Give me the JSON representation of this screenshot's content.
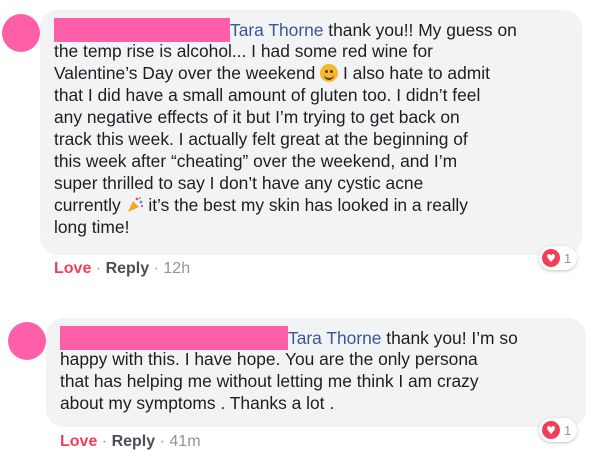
{
  "comments": [
    {
      "mention": "Tara Thorne",
      "lines": [
        " thank you!! My guess on",
        "the temp rise is alcohol... I had some red wine for",
        "Valentine’s Day over the weekend",
        " I also hate to admit",
        "that I did have a small amount of gluten too. I didn’t feel",
        "any negative effects of it but I’m trying to get back on",
        "track this week. I actually felt great at the beginning of",
        "this week after “cheating” over the weekend, and I’m",
        "super thrilled to say I don’t have any cystic acne",
        "currently",
        " it’s the best my skin has looked in a really",
        "long time!"
      ],
      "love_label": "Love",
      "reply_label": "Reply",
      "sep": "·",
      "time": "12h",
      "reaction_count": "1",
      "emoji_smile": "smiling-face-emoji",
      "emoji_party": "party-popper-emoji"
    },
    {
      "mention": "Tara Thorne",
      "lines": [
        " thank you! I’m so",
        "happy with this. I have hope. You are the only persona",
        "that has helping me without letting me think I am crazy",
        "about my symptoms . Thanks a lot ."
      ],
      "love_label": "Love",
      "reply_label": "Reply",
      "sep": "·",
      "time": "41m",
      "reaction_count": "1"
    }
  ],
  "colors": {
    "redaction": "#ff5fa8",
    "mention": "#385898",
    "love": "#f33e58",
    "bubble": "#f2f3f5"
  }
}
